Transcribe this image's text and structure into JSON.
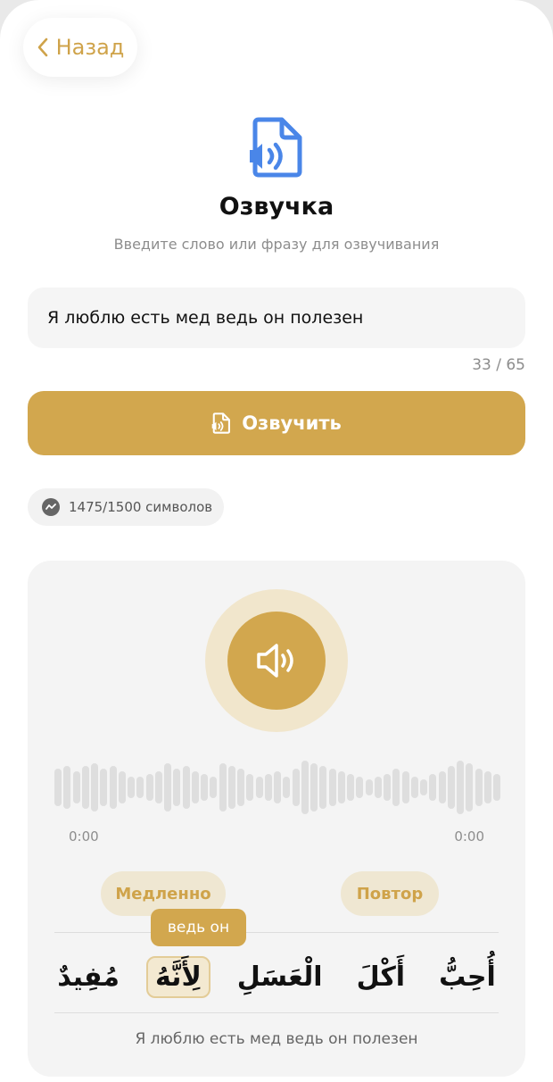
{
  "header": {
    "back_label": "Назад"
  },
  "hero": {
    "icon": "file-speaker-icon",
    "title": "Озвучка",
    "subtitle": "Введите слово или фразу для озвучивания"
  },
  "input": {
    "value": "Я люблю есть мед ведь он полезен",
    "counter": "33 / 65"
  },
  "speak_button": {
    "label": "Озвучить",
    "icon": "file-speaker-icon"
  },
  "quota": {
    "icon": "messenger-icon",
    "label": "1475/1500 символов"
  },
  "player": {
    "play_icon": "speaker-icon",
    "time_current": "0:00",
    "time_total": "0:00",
    "waveform_levels": [
      0.7,
      0.8,
      0.6,
      0.8,
      0.9,
      0.7,
      0.8,
      0.6,
      0.4,
      0.4,
      0.5,
      0.6,
      0.9,
      0.7,
      0.8,
      0.6,
      0.5,
      0.4,
      0.9,
      0.8,
      0.7,
      0.5,
      0.4,
      0.5,
      0.6,
      0.4,
      0.7,
      1.0,
      0.9,
      0.8,
      0.7,
      0.6,
      0.5,
      0.4,
      0.3,
      0.4,
      0.5,
      0.7,
      0.6,
      0.4,
      0.3,
      0.5,
      0.6,
      0.8,
      1.0,
      0.9,
      0.7,
      0.6,
      0.5
    ],
    "slow_label": "Медленно",
    "repeat_label": "Повтор",
    "tooltip": "ведь он",
    "words": [
      {
        "text": "أُحِبُّ",
        "active": false
      },
      {
        "text": "أَكْلَ",
        "active": false
      },
      {
        "text": "الْعَسَلِ",
        "active": false
      },
      {
        "text": "لِأَنَّهُ",
        "active": true
      },
      {
        "text": "مُفِيدٌ",
        "active": false
      }
    ],
    "translation": "Я люблю есть мед ведь он полезен"
  },
  "colors": {
    "accent": "#d2a74e",
    "accent_soft": "#efe7d2",
    "icon_blue": "#4a86e8"
  }
}
